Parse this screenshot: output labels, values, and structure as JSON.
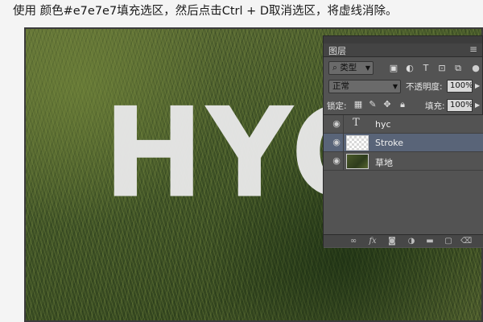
{
  "instruction": "使用 颜色#e7e7e7填充选区，然后点击Ctrl + D取消选区，将虚线消除。",
  "canvas": {
    "text": "HYC",
    "text_color": "#e7e7e7"
  },
  "layers_panel": {
    "tab": "图层",
    "filter": {
      "label": "类型"
    },
    "blend_mode": "正常",
    "opacity_label": "不透明度:",
    "opacity_value": "100%",
    "lock_label": "锁定:",
    "fill_label": "填充:",
    "fill_value": "100%",
    "layers": [
      {
        "name": "hyc",
        "kind": "text",
        "visible": true,
        "selected": false
      },
      {
        "name": "Stroke",
        "kind": "transparent",
        "visible": true,
        "selected": true
      },
      {
        "name": "草地",
        "kind": "image",
        "visible": true,
        "selected": false
      }
    ],
    "selection_color": "#596478"
  }
}
